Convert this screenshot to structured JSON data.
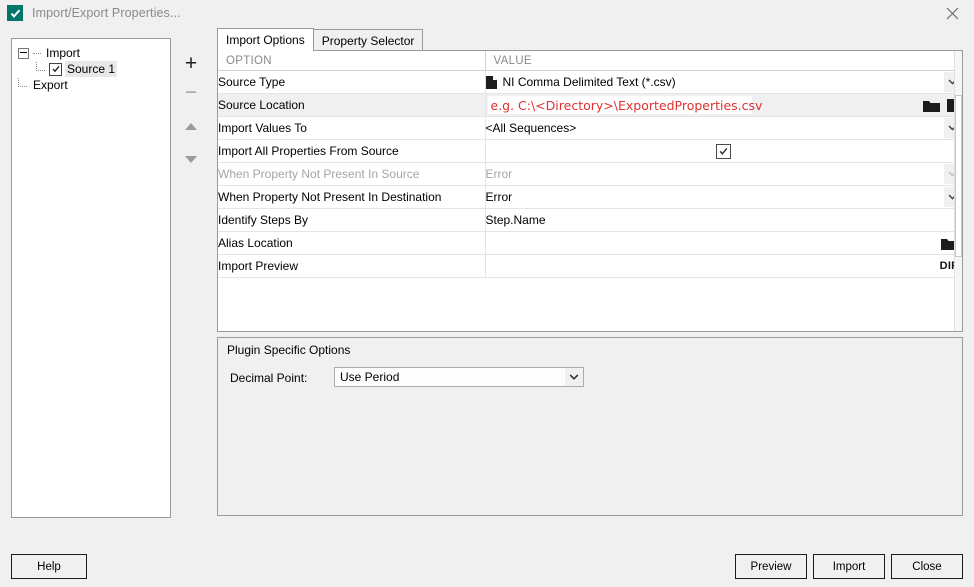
{
  "window": {
    "title": "Import/Export Properties...",
    "icon": "checkmark-icon",
    "close_label": "×"
  },
  "tree": {
    "nodes": [
      {
        "label": "Import",
        "type": "group",
        "expanded": true
      },
      {
        "label": "Source 1",
        "type": "checkbox-item",
        "checked": true,
        "selected": true
      },
      {
        "label": "Export",
        "type": "group",
        "expanded": false
      }
    ],
    "buttons": [
      {
        "name": "add-button",
        "glyph": "+",
        "enabled": true
      },
      {
        "name": "remove-button",
        "glyph": "−",
        "enabled": false
      },
      {
        "name": "move-up-button",
        "glyph": "▲",
        "enabled": false
      },
      {
        "name": "move-down-button",
        "glyph": "▼",
        "enabled": false
      }
    ]
  },
  "tabs": [
    {
      "label": "Import Options",
      "active": true
    },
    {
      "label": "Property Selector",
      "active": false
    }
  ],
  "options_table": {
    "headers": {
      "option": "OPTION",
      "value": "VALUE"
    },
    "rows": [
      {
        "option": "Source Type",
        "value": "NI Comma Delimited Text (*.csv)",
        "widget": "dropdown-with-file-icon",
        "disabled": false,
        "shaded": false
      },
      {
        "option": "Source Location",
        "value": "e.g. C:\\<Directory>\\ExportedProperties.csv",
        "widget": "text-input-with-browse",
        "disabled": false,
        "shaded": true,
        "placeholder": true
      },
      {
        "option": "Import Values To",
        "value": "<All Sequences>",
        "widget": "dropdown",
        "disabled": false,
        "shaded": false
      },
      {
        "option": "Import All Properties From Source",
        "value": "",
        "widget": "checkbox",
        "checked": true,
        "disabled": false,
        "shaded": false
      },
      {
        "option": "When Property Not Present In Source",
        "value": "Error",
        "widget": "dropdown",
        "disabled": true,
        "shaded": false
      },
      {
        "option": "When Property Not Present In Destination",
        "value": "Error",
        "widget": "dropdown",
        "disabled": false,
        "shaded": false
      },
      {
        "option": "Identify Steps By",
        "value": "Step.Name",
        "widget": "text",
        "disabled": false,
        "shaded": false
      },
      {
        "option": "Alias Location",
        "value": "",
        "widget": "browse-folder",
        "disabled": false,
        "shaded": false
      },
      {
        "option": "Import Preview",
        "value": "",
        "widget": "dif-button",
        "badge": "DIF",
        "disabled": false,
        "shaded": false
      }
    ]
  },
  "plugin_options": {
    "title": "Plugin Specific Options",
    "decimal_point_label": "Decimal Point:",
    "decimal_point_value": "Use Period"
  },
  "footer": {
    "help": "Help",
    "preview": "Preview",
    "import": "Import",
    "close": "Close"
  },
  "colors": {
    "accent": "#00756b",
    "placeholder_red": "#e03030",
    "panel_bg": "#f0f0f0",
    "border": "#9a9a9a"
  }
}
